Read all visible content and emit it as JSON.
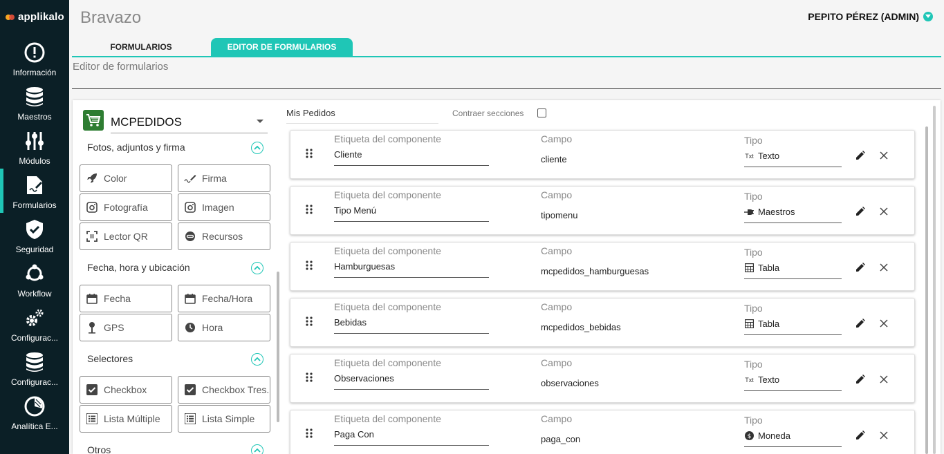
{
  "logo": "applikalo",
  "nav": [
    {
      "label": "Información",
      "icon": "alert-circle-icon"
    },
    {
      "label": "Maestros",
      "icon": "database-icon"
    },
    {
      "label": "Módulos",
      "icon": "sliders-icon"
    },
    {
      "label": "Formularios",
      "icon": "form-edit-icon",
      "active": true
    },
    {
      "label": "Seguridad",
      "icon": "shield-check-icon"
    },
    {
      "label": "Workflow",
      "icon": "workflow-icon"
    },
    {
      "label": "Configurac...",
      "icon": "gears-icon"
    },
    {
      "label": "Configurac...",
      "icon": "database-icon"
    },
    {
      "label": "Analítica E...",
      "icon": "pie-chart-icon"
    }
  ],
  "header": {
    "title": "Bravazo",
    "user": "PEPITO PÉREZ (ADMIN)"
  },
  "tabs": [
    {
      "label": "FORMULARIOS"
    },
    {
      "label": "EDITOR DE FORMULARIOS",
      "active": true
    }
  ],
  "subtitle": "Editor de formularios",
  "palette": {
    "form_name": "MCPEDIDOS",
    "sections": [
      {
        "title": "Fotos, adjuntos y firma",
        "items": [
          {
            "label": "Color",
            "icon": "rocket-icon"
          },
          {
            "label": "Firma",
            "icon": "signature-icon"
          },
          {
            "label": "Fotografía",
            "icon": "camera-icon"
          },
          {
            "label": "Imagen",
            "icon": "camera-icon"
          },
          {
            "label": "Lector QR",
            "icon": "qr-scan-icon"
          },
          {
            "label": "Recursos",
            "icon": "link-icon"
          }
        ]
      },
      {
        "title": "Fecha, hora y ubicación",
        "items": [
          {
            "label": "Fecha",
            "icon": "calendar-icon"
          },
          {
            "label": "Fecha/Hora",
            "icon": "calendar-icon"
          },
          {
            "label": "GPS",
            "icon": "pin-icon"
          },
          {
            "label": "Hora",
            "icon": "clock-icon"
          }
        ]
      },
      {
        "title": "Selectores",
        "items": [
          {
            "label": "Checkbox",
            "icon": "checkbox-icon"
          },
          {
            "label": "Checkbox Tres...",
            "icon": "checkbox-icon"
          },
          {
            "label": "Lista Múltiple",
            "icon": "list-icon"
          },
          {
            "label": "Lista Simple",
            "icon": "list-icon"
          }
        ]
      },
      {
        "title": "Otros",
        "items": []
      }
    ]
  },
  "editor": {
    "form_title": "Mis Pedidos",
    "collapse_label": "Contraer secciones",
    "label_header": "Etiqueta del componente",
    "field_header": "Campo",
    "type_header": "Tipo",
    "components": [
      {
        "label": "Cliente",
        "field": "cliente",
        "type": "Texto",
        "type_icon": "Txt"
      },
      {
        "label": "Tipo Menú",
        "field": "tipomenu",
        "type": "Maestros",
        "type_icon": "plug-icon"
      },
      {
        "label": "Hamburguesas",
        "field": "mcpedidos_hamburguesas",
        "type": "Tabla",
        "type_icon": "table-icon"
      },
      {
        "label": "Bebidas",
        "field": "mcpedidos_bebidas",
        "type": "Tabla",
        "type_icon": "table-icon"
      },
      {
        "label": "Observaciones",
        "field": "observaciones",
        "type": "Texto",
        "type_icon": "Txt"
      },
      {
        "label": "Paga Con",
        "field": "paga_con",
        "type": "Moneda",
        "type_icon": "coin-icon"
      }
    ]
  },
  "colors": {
    "accent": "#1fc6b6",
    "sidebar": "#0b1f26",
    "cart": "#2e7d32"
  }
}
